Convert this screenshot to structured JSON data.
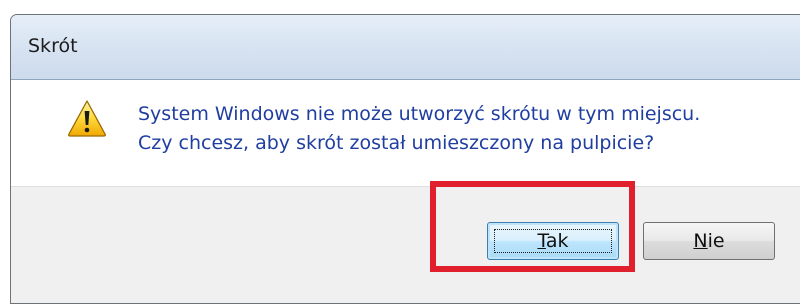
{
  "window": {
    "title": "Skrót"
  },
  "message": {
    "icon": "warning-icon",
    "line1": "System Windows nie może utworzyć skrótu w tym miejscu.",
    "line2": "Czy chcesz, aby skrót został umieszczony na pulpicie?"
  },
  "buttons": {
    "yes_mnemonic": "T",
    "yes_rest": "ak",
    "no_mnemonic": "N",
    "no_rest": "ie"
  },
  "colors": {
    "message_text": "#1f3ea0",
    "highlight": "#e0202c",
    "default_button_border": "#3c7fb1"
  }
}
